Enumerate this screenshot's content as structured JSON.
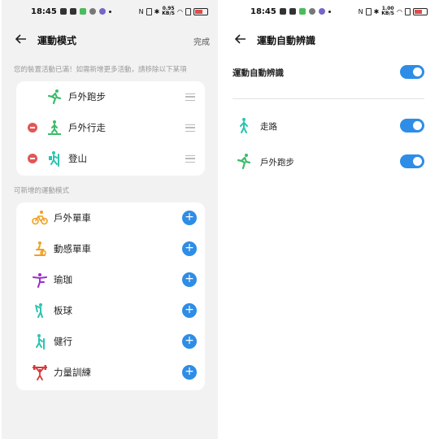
{
  "status": {
    "time": "18:45",
    "net_speed_left": "0.95",
    "net_speed_right": "1.00",
    "net_unit": "KB/S"
  },
  "left": {
    "title": "運動模式",
    "done_label": "完成",
    "hint": "您的裝置活動已滿！如需新增更多活動，請移除以下某項",
    "current": [
      {
        "label": "戶外跑步",
        "icon": "running-icon",
        "removable": false
      },
      {
        "label": "戶外行走",
        "icon": "walking-icon",
        "removable": true
      },
      {
        "label": "登山",
        "icon": "hiking-icon",
        "removable": true
      }
    ],
    "addable_label": "可新增的運動模式",
    "addable": [
      {
        "label": "戶外單車",
        "icon": "cycling-icon"
      },
      {
        "label": "動感單車",
        "icon": "spin-bike-icon"
      },
      {
        "label": "瑜珈",
        "icon": "yoga-icon"
      },
      {
        "label": "板球",
        "icon": "cricket-icon"
      },
      {
        "label": "健行",
        "icon": "trekking-icon"
      },
      {
        "label": "力量訓練",
        "icon": "weightlifting-icon"
      }
    ]
  },
  "right": {
    "title": "運動自動辨識",
    "master": {
      "label": "運動自動辨識",
      "on": true
    },
    "items": [
      {
        "label": "走路",
        "icon": "walking-icon",
        "on": true
      },
      {
        "label": "戶外跑步",
        "icon": "running-icon",
        "on": true
      }
    ]
  },
  "colors": {
    "accent": "#2e8de6",
    "remove": "#e25656",
    "teal": "#2bc4b0",
    "green": "#3dbb6a",
    "orange": "#f0a020",
    "purple": "#9a2fc9",
    "red": "#d83a3a"
  }
}
